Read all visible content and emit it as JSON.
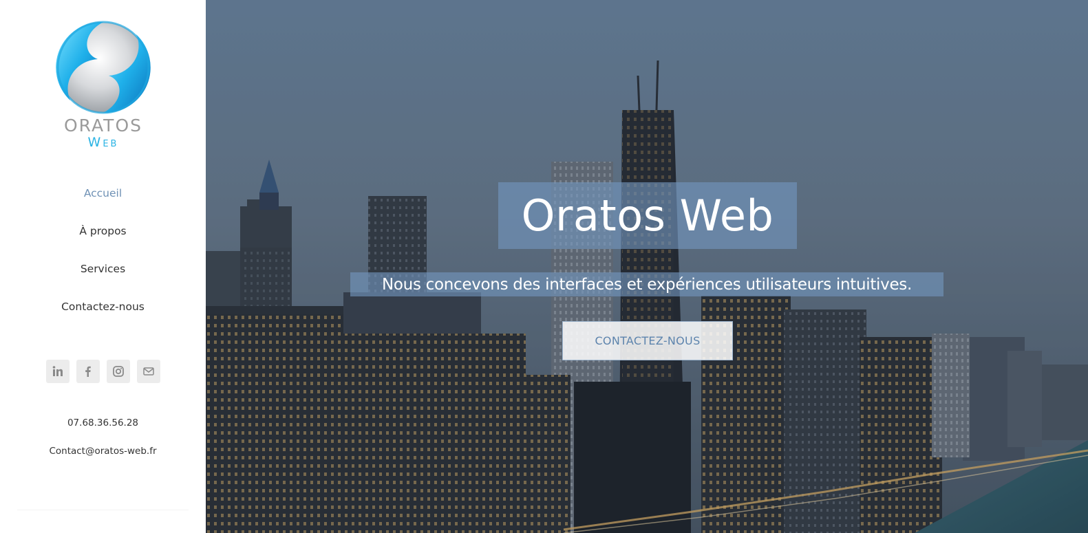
{
  "brand": {
    "logo_line1": "ORATOS",
    "logo_line2": "Web",
    "colors": {
      "logo_blue": "#2cb4e4",
      "logo_gray": "#9a9a9a",
      "accent": "#6f91b5"
    }
  },
  "nav": {
    "items": [
      {
        "label": "Accueil",
        "active": true
      },
      {
        "label": "À propos",
        "active": false
      },
      {
        "label": "Services",
        "active": false
      },
      {
        "label": "Contactez-nous",
        "active": false
      }
    ]
  },
  "social": {
    "icons": [
      "linkedin-icon",
      "facebook-icon",
      "instagram-icon",
      "mail-icon"
    ]
  },
  "contact": {
    "phone": "07.68.36.56.28",
    "email": "Contact@oratos-web.fr"
  },
  "hero": {
    "title": "Oratos Web",
    "subtitle": "Nous concevons des interfaces et expériences utilisateurs intuitives.",
    "cta_label": "CONTACTEZ-NOUS"
  }
}
